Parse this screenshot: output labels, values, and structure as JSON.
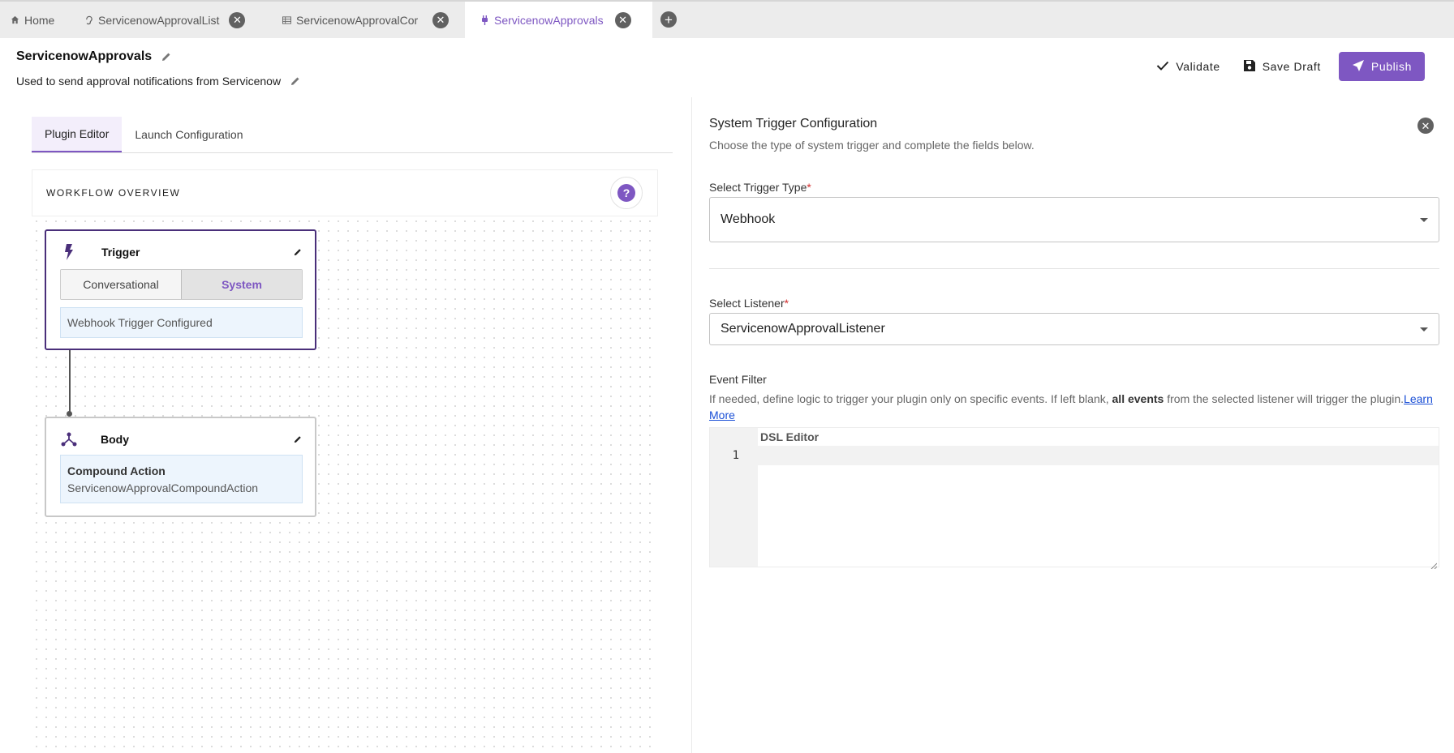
{
  "tabs": [
    {
      "label": "Home",
      "icon": "home-icon"
    },
    {
      "label": "ServicenowApprovalList",
      "icon": "ear-icon"
    },
    {
      "label": "ServicenowApprovalCor",
      "icon": "table-icon"
    },
    {
      "label": "ServicenowApprovals",
      "icon": "plug-icon",
      "active": true
    }
  ],
  "header": {
    "title": "ServicenowApprovals",
    "description": "Used to send approval notifications from Servicenow"
  },
  "actions": {
    "validate_label": "Validate",
    "save_draft_label": "Save Draft",
    "publish_label": "Publish"
  },
  "editor_tabs": {
    "plugin_editor": "Plugin Editor",
    "launch_configuration": "Launch Configuration"
  },
  "workflow": {
    "overview_title": "WORKFLOW OVERVIEW",
    "help_symbol": "?",
    "trigger": {
      "title": "Trigger",
      "mode_conversational": "Conversational",
      "mode_system": "System",
      "status": "Webhook Trigger Configured"
    },
    "body": {
      "title": "Body",
      "action_type": "Compound Action",
      "action_name": "ServicenowApprovalCompoundAction"
    }
  },
  "trigger_config": {
    "title": "System Trigger Configuration",
    "subtitle": "Choose the type of system trigger and complete the fields below.",
    "trigger_type_label": "Select Trigger Type",
    "trigger_type_value": "Webhook",
    "listener_label": "Select Listener",
    "listener_value": "ServicenowApprovalListener",
    "required_mark": "*",
    "event_filter_label": "Event Filter",
    "event_filter_desc_1": "If needed, define logic to trigger your plugin only on specific events. If left blank, ",
    "event_filter_desc_bold": "all events",
    "event_filter_desc_2": " from the selected listener will trigger the plugin.",
    "learn_more": "Learn More",
    "dsl_editor_label": "DSL Editor",
    "line_number": "1"
  },
  "colors": {
    "accent": "#7e57c2",
    "trigger_border": "#4a2f7a",
    "info_bg": "#edf5fd",
    "link": "#1a4fd6",
    "required": "#d32f2f"
  }
}
